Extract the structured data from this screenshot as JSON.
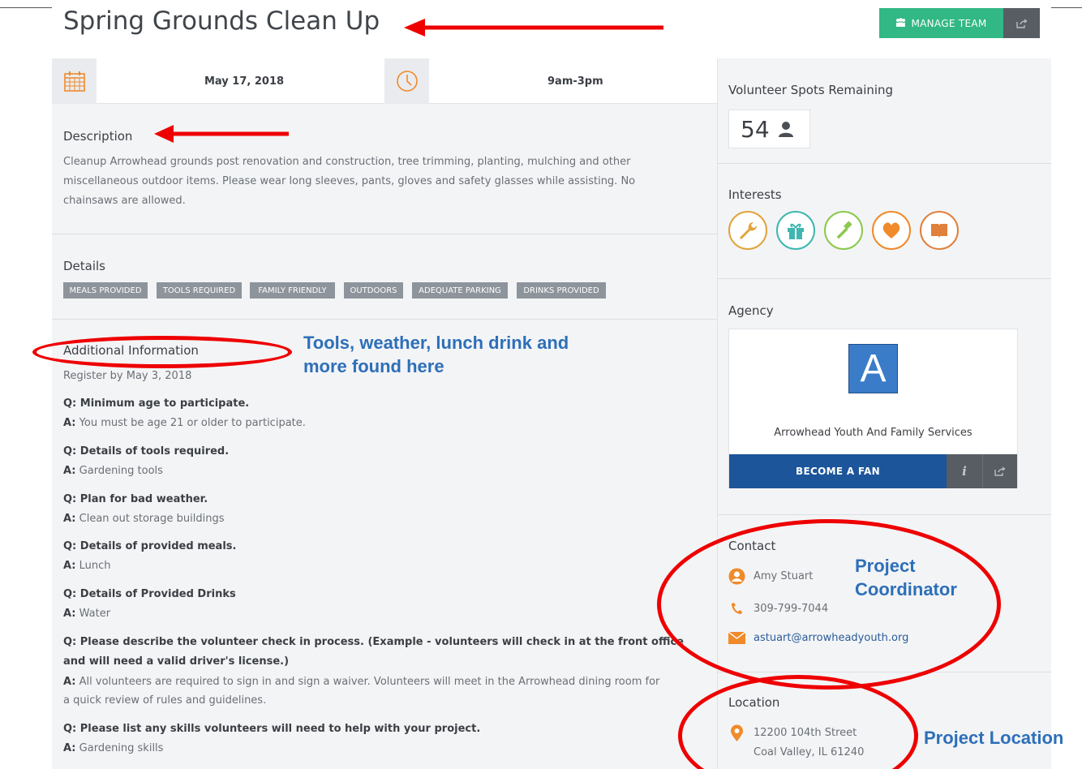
{
  "page": {
    "title": "Spring Grounds Clean Up",
    "manage_team_label": "MANAGE TEAM",
    "date": "May 17, 2018",
    "time": "9am-3pm"
  },
  "description": {
    "heading": "Description",
    "lines": [
      "Cleanup Arrowhead grounds post renovation and construction, tree trimming, planting, mulching and other",
      "miscellaneous outdoor items. Please wear long sleeves, pants, gloves and safety glasses while assisting.  No",
      "chainsaws are allowed."
    ]
  },
  "details": {
    "heading": "Details",
    "tags": [
      "MEALS PROVIDED",
      "TOOLS REQUIRED",
      "FAMILY FRIENDLY",
      "OUTDOORS",
      "ADEQUATE PARKING",
      "DRINKS PROVIDED"
    ]
  },
  "additional": {
    "heading": "Additional Information",
    "register_by": "Register by May 3, 2018",
    "q_prefix": "Q:",
    "a_prefix": "A:",
    "qa": [
      {
        "q": "Minimum age to participate.",
        "a": "You must be age 21 or older to participate."
      },
      {
        "q": "Details of tools required.",
        "a": "Gardening tools"
      },
      {
        "q": "Plan for bad weather.",
        "a": "Clean out storage buildings"
      },
      {
        "q": "Details of provided meals.",
        "a": "Lunch"
      },
      {
        "q": "Details of Provided Drinks",
        "a": "Water"
      },
      {
        "q1": "Please describe the volunteer check in process. (Example - volunteers will check in at the front office",
        "q2": "and will need a valid driver's license.)",
        "a1": " All volunteers are required to sign in and sign a waiver. Volunteers will meet in the Arrowhead dining room for",
        "a2": "a quick review of rules and guidelines."
      },
      {
        "q": "Please list any skills volunteers will need to help with your project.",
        "a": " Gardening skills"
      }
    ]
  },
  "sidebar": {
    "spots_heading": "Volunteer Spots Remaining",
    "spots_count": "54",
    "interests_heading": "Interests",
    "interests": [
      {
        "icon": "wrench-icon",
        "color": "#e0a33a"
      },
      {
        "icon": "gift-icon",
        "color": "#3fb6b0"
      },
      {
        "icon": "hammer-icon",
        "color": "#8cc84b"
      },
      {
        "icon": "heart-icon",
        "color": "#f08a2a"
      },
      {
        "icon": "book-icon",
        "color": "#e0803a"
      }
    ],
    "agency_heading": "Agency",
    "agency_logo_letter": "A",
    "agency_name": "Arrowhead Youth And Family Services",
    "become_fan_label": "BECOME A FAN",
    "info_label": "i",
    "contact_heading": "Contact",
    "contact_name": "Amy Stuart",
    "contact_phone": "309-799-7044",
    "contact_email": "astuart@arrowheadyouth.org",
    "location_heading": "Location",
    "address_line1": "12200 104th Street",
    "address_line2": "Coal Valley, IL 61240"
  },
  "annotations": {
    "tools_note": "Tools, weather, lunch drink and more found here",
    "coordinator_note": "Project Coordinator",
    "location_note": "Project Location",
    "arrow_color": "#ee0000",
    "note_color": "#2d6fb8"
  },
  "colors": {
    "accent_green": "#32b884",
    "fan_blue": "#1c5599",
    "orange_icon": "#f08a2a"
  }
}
